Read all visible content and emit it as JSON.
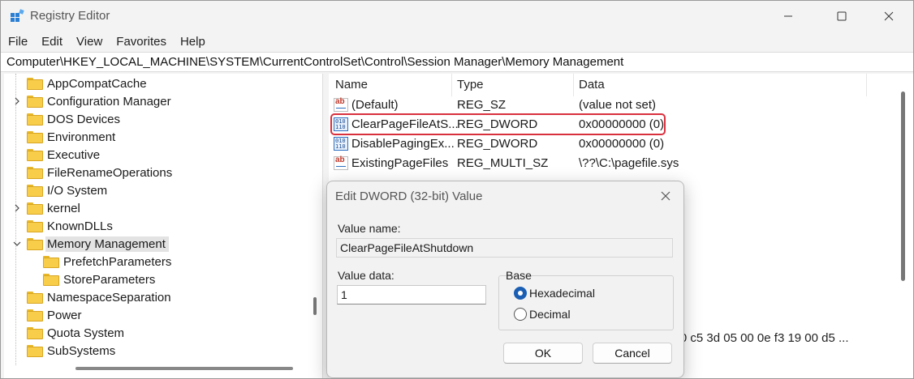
{
  "window": {
    "title": "Registry Editor"
  },
  "menu": [
    "File",
    "Edit",
    "View",
    "Favorites",
    "Help"
  ],
  "address": "Computer\\HKEY_LOCAL_MACHINE\\SYSTEM\\CurrentControlSet\\Control\\Session Manager\\Memory Management",
  "tree": {
    "items": [
      {
        "label": "AppCompatCache",
        "expander": "none"
      },
      {
        "label": "Configuration Manager",
        "expander": "collapsed"
      },
      {
        "label": "DOS Devices",
        "expander": "none"
      },
      {
        "label": "Environment",
        "expander": "none"
      },
      {
        "label": "Executive",
        "expander": "none"
      },
      {
        "label": "FileRenameOperations",
        "expander": "none"
      },
      {
        "label": "I/O System",
        "expander": "none"
      },
      {
        "label": "kernel",
        "expander": "collapsed"
      },
      {
        "label": "KnownDLLs",
        "expander": "none"
      },
      {
        "label": "Memory Management",
        "expander": "expanded",
        "selected": true
      },
      {
        "label": "PrefetchParameters",
        "expander": "none",
        "child": true
      },
      {
        "label": "StoreParameters",
        "expander": "none",
        "child": true
      },
      {
        "label": "NamespaceSeparation",
        "expander": "none"
      },
      {
        "label": "Power",
        "expander": "none"
      },
      {
        "label": "Quota System",
        "expander": "none"
      },
      {
        "label": "SubSystems",
        "expander": "none"
      }
    ]
  },
  "list": {
    "headers": {
      "name": "Name",
      "type": "Type",
      "data": "Data"
    },
    "rows": [
      {
        "name": "(Default)",
        "type": "REG_SZ",
        "data": "(value not set)",
        "icon": "string-value-icon"
      },
      {
        "name": "ClearPageFileAtS...",
        "type": "REG_DWORD",
        "data": "0x00000000 (0)",
        "icon": "binary-value-icon"
      },
      {
        "name": "DisablePagingEx...",
        "type": "REG_DWORD",
        "data": "0x00000000 (0)",
        "icon": "binary-value-icon"
      },
      {
        "name": "ExistingPageFiles",
        "type": "REG_MULTI_SZ",
        "data": "\\??\\C:\\pagefile.sys",
        "icon": "string-value-icon"
      }
    ],
    "partial_row_data": "3 00 c5 3d 05 00 0e f3 19 00 d5 ..."
  },
  "dialog": {
    "title": "Edit DWORD (32-bit) Value",
    "value_name_label": "Value name:",
    "value_name": "ClearPageFileAtShutdown",
    "value_data_label": "Value data:",
    "value_data": "1",
    "base_label": "Base",
    "hex_label": "Hexadecimal",
    "dec_label": "Decimal",
    "base_selected": "Hexadecimal",
    "ok_label": "OK",
    "cancel_label": "Cancel"
  },
  "colors": {
    "highlight": "#d9303d",
    "folder": "#f7cd4a",
    "radio_selected": "#1a5fb4"
  }
}
